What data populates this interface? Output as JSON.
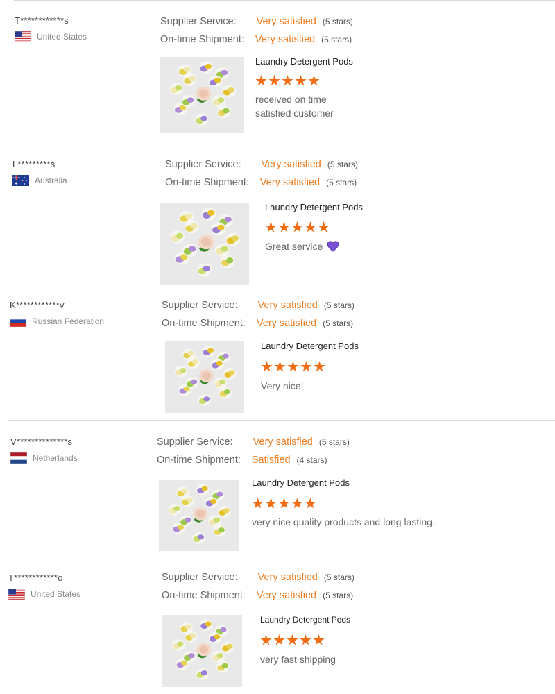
{
  "labels": {
    "supplier_service": "Supplier Service:",
    "ontime_shipment": "On-time Shipment:"
  },
  "colors": {
    "rating_orange": "#ef7d22",
    "star_orange": "#f36d14",
    "divider": "#d8d8d8",
    "heart_purple": "#7b52d6"
  },
  "reviews": [
    {
      "name": "T************s",
      "country": "United States",
      "flag": "us-flag-icon",
      "supplier_value": "Very satisfied",
      "supplier_stars": "(5 stars)",
      "shipment_value": "Very satisfied",
      "shipment_stars": "(5 stars)",
      "product": "Laundry Detergent Pods",
      "rating": 5,
      "comment_lines": [
        "received on time",
        "satisfied customer"
      ]
    },
    {
      "name": "L*********s",
      "country": "Australia",
      "flag": "au-flag-icon",
      "supplier_value": "Very satisfied",
      "supplier_stars": "(5 stars)",
      "shipment_value": "Very satisfied",
      "shipment_stars": "(5 stars)",
      "product": "Laundry Detergent Pods",
      "rating": 5,
      "comment_lines": [
        "Great service"
      ],
      "comment_icon": "purple-heart-icon"
    },
    {
      "name": "K************v",
      "country": "Russian Federation",
      "flag": "ru-flag-icon",
      "supplier_value": "Very satisfied",
      "supplier_stars": "(5 stars)",
      "shipment_value": "Very satisfied",
      "shipment_stars": "(5 stars)",
      "product": "Laundry Detergent Pods",
      "rating": 5,
      "comment_lines": [
        "Very nice!"
      ]
    },
    {
      "name": "V**************s",
      "country": "Netherlands",
      "flag": "nl-flag-icon",
      "supplier_value": "Very satisfied",
      "supplier_stars": "(5 stars)",
      "shipment_value": "Satisfied",
      "shipment_stars": "(4 stars)",
      "product": "Laundry Detergent Pods",
      "rating": 5,
      "comment_lines": [
        "very nice quality products and long lasting."
      ]
    },
    {
      "name": "T************o",
      "country": "United States",
      "flag": "us-flag-icon",
      "supplier_value": "Very satisfied",
      "supplier_stars": "(5 stars)",
      "shipment_value": "Very satisfied",
      "shipment_stars": "(5 stars)",
      "product": "Laundry Detergent Pods",
      "rating": 5,
      "comment_lines": [
        "very fast shipping"
      ]
    }
  ]
}
